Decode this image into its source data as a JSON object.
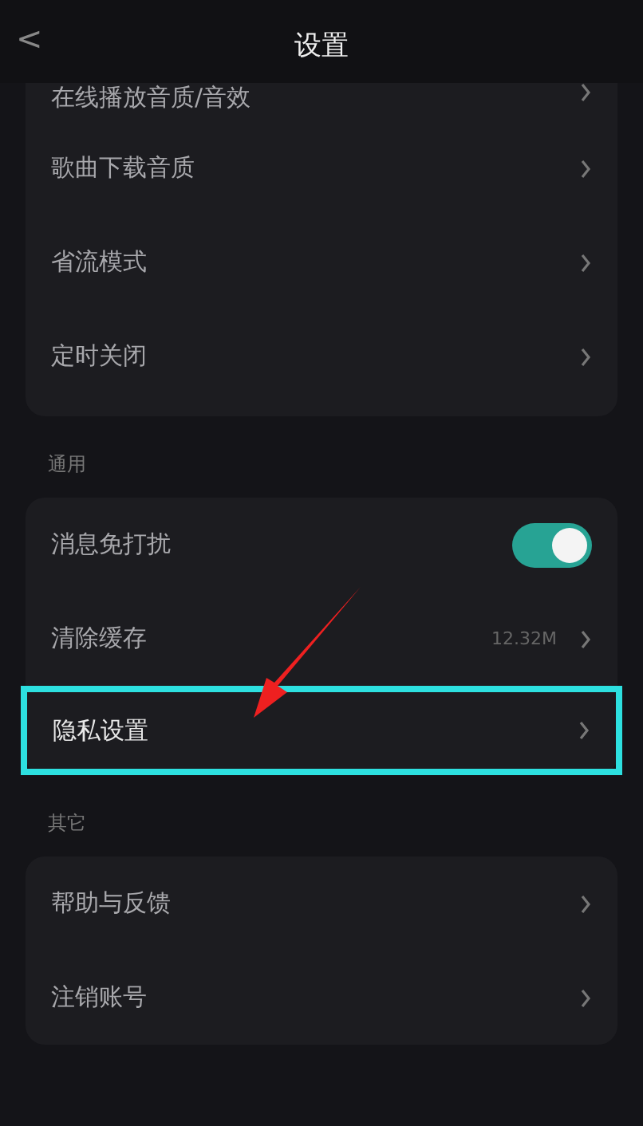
{
  "header": {
    "back": "<",
    "title": "设置"
  },
  "sections": [
    {
      "items": [
        {
          "kind": "link",
          "label": "在线播放音质/音效"
        },
        {
          "kind": "link",
          "label": "歌曲下载音质"
        },
        {
          "kind": "link",
          "label": "省流模式"
        },
        {
          "kind": "link",
          "label": "定时关闭"
        }
      ]
    },
    {
      "title": "通用",
      "items": [
        {
          "kind": "toggle",
          "label": "消息免打扰",
          "on": true
        },
        {
          "kind": "value",
          "label": "清除缓存",
          "value": "12.32M"
        },
        {
          "kind": "link",
          "label": "隐私设置",
          "highlighted": true
        }
      ]
    },
    {
      "title": "其它",
      "items": [
        {
          "kind": "link",
          "label": "帮助与反馈"
        },
        {
          "kind": "link",
          "label": "注销账号"
        }
      ]
    }
  ]
}
